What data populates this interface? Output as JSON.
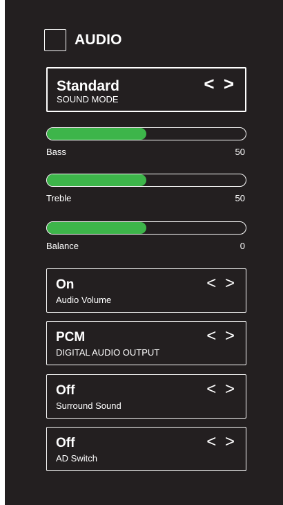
{
  "header": {
    "title": "AUDIO",
    "icon": "checkbox-square-icon"
  },
  "sound_mode": {
    "value": "Standard",
    "label": "SOUND MODE",
    "arrows": "< >"
  },
  "sliders": [
    {
      "label": "Bass",
      "value": "50",
      "level": 0.5
    },
    {
      "label": "Treble",
      "value": "50",
      "level": 0.5
    },
    {
      "label": "Balance",
      "value": "0",
      "level": 0.5
    }
  ],
  "options": [
    {
      "value": "On",
      "label": "Audio Volume",
      "arrows": "< >"
    },
    {
      "value": "PCM",
      "label": "DIGITAL AUDIO OUTPUT",
      "arrows": "< >"
    },
    {
      "value": "Off",
      "label": "Surround Sound",
      "arrows": "< >"
    },
    {
      "value": "Off",
      "label": "AD Switch",
      "arrows": "< >"
    }
  ],
  "colors": {
    "background": "#231f20",
    "accent": "#3db54a",
    "text": "#ffffff"
  }
}
